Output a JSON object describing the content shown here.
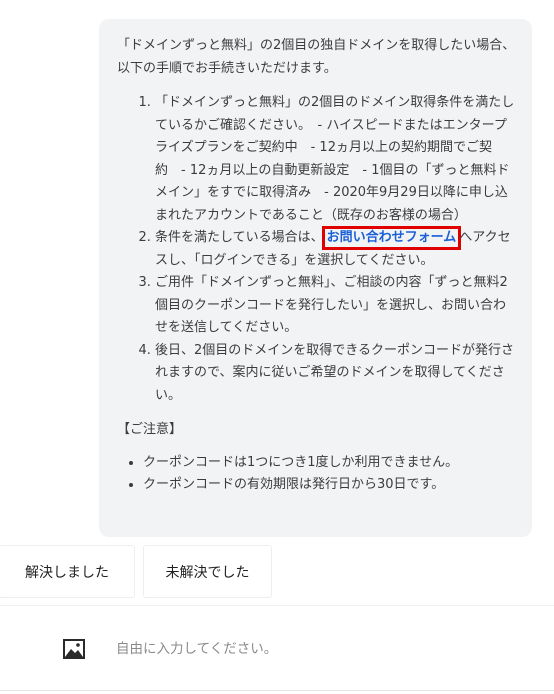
{
  "message": {
    "intro": "「ドメインずっと無料」の2個目の独自ドメインを取得したい場合、以下の手順でお手続きいただけます。",
    "steps": [
      {
        "text": "「ドメインずっと無料」の2個目のドメイン取得条件を満たしているかご確認ください。　- ハイスピードまたはエンタープライズプランをご契約中　- 12ヵ月以上の契約期間でご契約　- 12ヵ月以上の自動更新設定　- 1個目の「ずっと無料ドメイン」をすでに取得済み　- 2020年9月29日以降に申し込まれたアカウントであること（既存のお客様の場合）"
      },
      {
        "before": "条件を満たしている場合は、",
        "link": "お問い合わせフォーム",
        "after": "へアクセスし、「ログインできる」を選択してください。"
      },
      {
        "text": "ご用件「ドメインずっと無料」、ご相談の内容「ずっと無料2個目のクーポンコードを発行したい」を選択し、お問い合わせを送信してください。"
      },
      {
        "text": "後日、2個目のドメインを取得できるクーポンコードが発行されますので、案内に従いご希望のドメインを取得してください。"
      }
    ],
    "notes_title": "【ご注意】",
    "notes": [
      "クーポンコードは1つにつき1度しか利用できません。",
      "クーポンコードの有効期限は発行日から30日です。"
    ]
  },
  "feedback": {
    "resolved_label": "解決しました",
    "unresolved_label": "未解決でした"
  },
  "composer": {
    "image_icon": "image-icon",
    "placeholder": "自由に入力してください。",
    "value": ""
  },
  "colors": {
    "bubble_bg": "#f2f3f5",
    "link": "#1a5fd6",
    "highlight_border": "#e00000"
  }
}
